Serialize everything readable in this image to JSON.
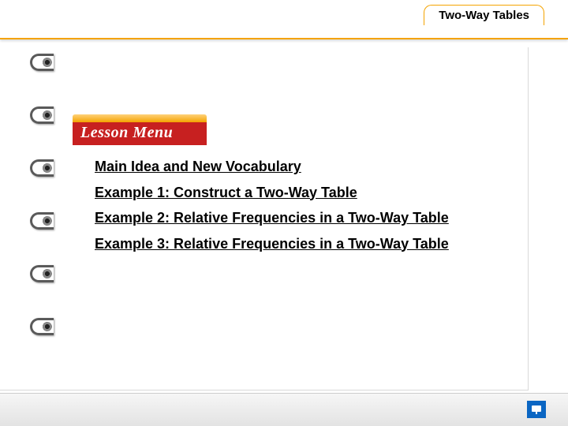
{
  "header": {
    "title": "Two-Way Tables"
  },
  "banner": {
    "label": "Lesson Menu"
  },
  "menu": {
    "items": [
      {
        "text": "Main Idea and New Vocabulary"
      },
      {
        "text": "Example 1:  Construct a Two-Way Table"
      },
      {
        "text": "Example 2:  Relative Frequencies in a Two-Way Table"
      },
      {
        "text": "Example 3:  Relative Frequencies in a Two-Way Table"
      }
    ]
  },
  "controls": {
    "present_icon": "present-icon"
  }
}
